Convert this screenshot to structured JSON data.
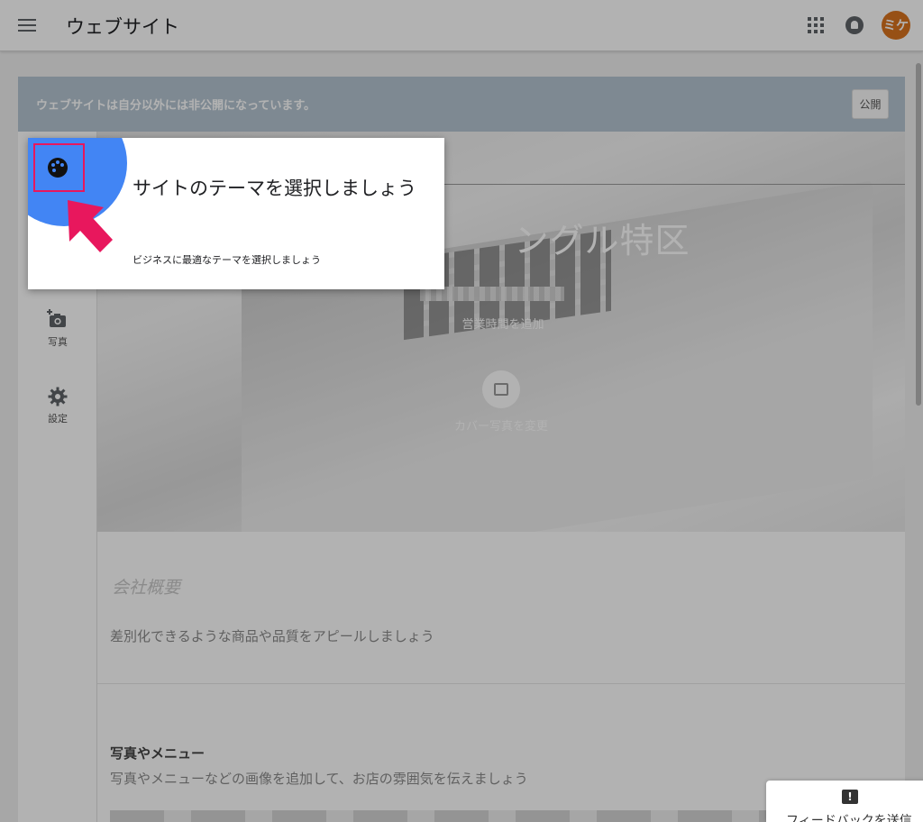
{
  "appbar": {
    "title": "ウェブサイト",
    "avatar_text": "ミケ"
  },
  "banner": {
    "message": "ウェブサイトは自分以外には非公開になっています。",
    "publish_label": "公開"
  },
  "left_rail": {
    "items": [
      {
        "label": "写真",
        "icon": "add-photo-icon"
      },
      {
        "label": "設定",
        "icon": "gear-icon"
      }
    ]
  },
  "cover": {
    "business_name": "ングル特区",
    "hours_link": "営業時間を追加",
    "change_cover_label": "カバー写真を変更"
  },
  "sections": {
    "about_title": "会社概要",
    "about_desc": "差別化できるような商品や品質をアピールしましょう",
    "photos_title": "写真やメニュー",
    "photos_desc": "写真やメニューなどの画像を追加して、お店の雰囲気を伝えましょう"
  },
  "tour": {
    "title": "サイトのテーマを選択しましょう",
    "description": "ビジネスに最適なテーマを選択しましょう",
    "icon": "palette-icon"
  },
  "feedback": {
    "label": "フィードバックを送信"
  },
  "colors": {
    "accent_blue": "#4285f4",
    "highlight": "#e8175d",
    "avatar": "#d9731f",
    "banner": "#b5c5d2"
  }
}
